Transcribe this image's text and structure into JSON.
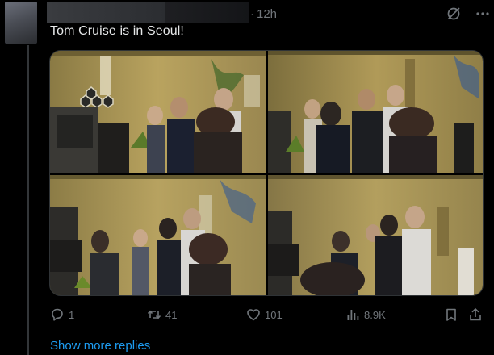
{
  "post": {
    "timestamp": "12h",
    "separator": "·",
    "text": "Tom Cruise is in Seoul!",
    "image_count": 4
  },
  "actions": {
    "replies": "1",
    "reposts": "41",
    "likes": "101",
    "views": "8.9K"
  },
  "thread": {
    "show_more_label": "Show more replies"
  },
  "icons": {
    "grok": "grok-icon",
    "more": "more-icon",
    "reply": "reply-icon",
    "repost": "repost-icon",
    "like": "heart-icon",
    "views": "analytics-icon",
    "bookmark": "bookmark-icon",
    "share": "share-icon"
  },
  "colors": {
    "background": "#000000",
    "text": "#e7e9ea",
    "muted": "#71767b",
    "link": "#1d9bf0",
    "border": "#2f3336"
  }
}
